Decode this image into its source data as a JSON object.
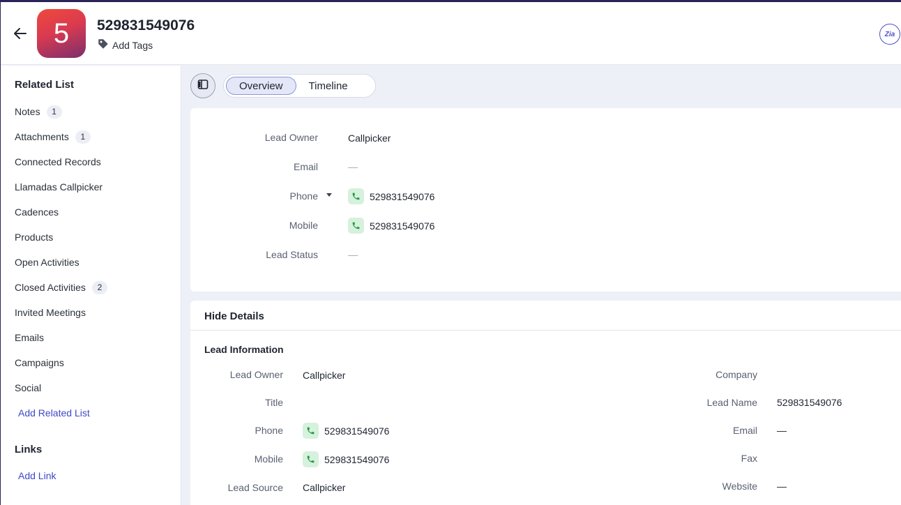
{
  "header": {
    "record_title": "529831549076",
    "avatar_letter": "5",
    "add_tags_label": "Add Tags",
    "zia_label": "Zia"
  },
  "sidebar": {
    "related_list_heading": "Related List",
    "items": [
      {
        "label": "Notes",
        "count": "1"
      },
      {
        "label": "Attachments",
        "count": "1"
      },
      {
        "label": "Connected Records",
        "count": null
      },
      {
        "label": "Llamadas Callpicker",
        "count": null
      },
      {
        "label": "Cadences",
        "count": null
      },
      {
        "label": "Products",
        "count": null
      },
      {
        "label": "Open Activities",
        "count": null
      },
      {
        "label": "Closed Activities",
        "count": "2"
      },
      {
        "label": "Invited Meetings",
        "count": null
      },
      {
        "label": "Emails",
        "count": null
      },
      {
        "label": "Campaigns",
        "count": null
      },
      {
        "label": "Social",
        "count": null
      }
    ],
    "add_related_list": "Add Related List",
    "links_heading": "Links",
    "add_link": "Add Link"
  },
  "tabs": [
    {
      "label": "Overview",
      "active": true
    },
    {
      "label": "Timeline",
      "active": false
    }
  ],
  "overview": {
    "lead_owner": {
      "label": "Lead Owner",
      "value": "Callpicker"
    },
    "email": {
      "label": "Email",
      "value": "—"
    },
    "phone": {
      "label": "Phone",
      "value": "529831549076"
    },
    "mobile": {
      "label": "Mobile",
      "value": "529831549076"
    },
    "lead_status": {
      "label": "Lead Status",
      "value": "—"
    }
  },
  "details": {
    "hide_details_label": "Hide Details",
    "section_title": "Lead Information",
    "left": {
      "lead_owner": {
        "label": "Lead Owner",
        "value": "Callpicker"
      },
      "title": {
        "label": "Title",
        "value": ""
      },
      "phone": {
        "label": "Phone",
        "value": "529831549076"
      },
      "mobile": {
        "label": "Mobile",
        "value": "529831549076"
      },
      "lead_source": {
        "label": "Lead Source",
        "value": "Callpicker"
      }
    },
    "right": {
      "company": {
        "label": "Company",
        "value": ""
      },
      "lead_name": {
        "label": "Lead Name",
        "value": "529831549076"
      },
      "email": {
        "label": "Email",
        "value": "—"
      },
      "fax": {
        "label": "Fax",
        "value": ""
      },
      "website": {
        "label": "Website",
        "value": "—"
      }
    }
  },
  "colors": {
    "accent": "#3c49c6",
    "phone_chip": "#d6f1dc",
    "phone_icon": "#1f9a45"
  }
}
